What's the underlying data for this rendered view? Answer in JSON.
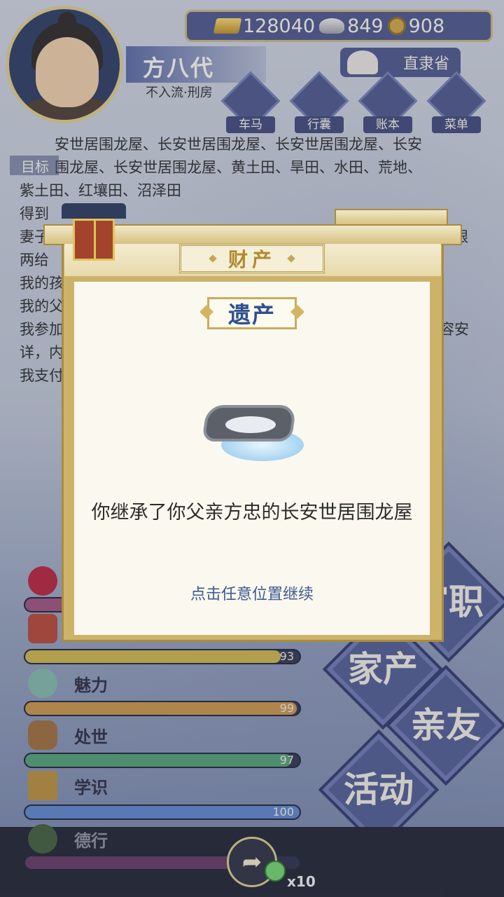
{
  "header": {
    "player_name": "方八代",
    "player_subtitle": "不入流·刑房",
    "resources": {
      "gold": "128040",
      "silver": "849",
      "coins": "908"
    },
    "province": "直隶省",
    "menu": [
      {
        "label": "车马",
        "icon": "carriage-icon"
      },
      {
        "label": "行囊",
        "icon": "bag-icon"
      },
      {
        "label": "账本",
        "icon": "ledger-icon"
      },
      {
        "label": "菜单",
        "icon": "more-icon"
      }
    ]
  },
  "background_text": {
    "goal_tag": "目标",
    "lines": [
      "安世居围龙屋、长安世居围龙屋、长安世居围龙屋、长安",
      "围龙屋、长安世居围龙屋、黄土田、旱田、水田、荒地、",
      "紫土田、红壤田、沼泽田",
      "得到",
      "妻子",
      "两给",
      "我的孩",
      "我的父",
      "我参加",
      "详，内",
      "我支付"
    ],
    "right_fragments": [
      "银",
      "容安"
    ]
  },
  "modal": {
    "title": "财产",
    "subtitle": "遗产",
    "message": "你继承了你父亲方忠的长安世居围龙屋",
    "hint": "点击任意位置继续",
    "item_icon": "walled-house-icon"
  },
  "attributes": [
    {
      "label": "",
      "value": 93,
      "max": 100,
      "color": "#c7b04a",
      "icon": "flower-icon"
    },
    {
      "label": "魅力",
      "value": 99,
      "max": 100,
      "color": "#c49048",
      "icon": "jade-icon"
    },
    {
      "label": "处世",
      "value": 97,
      "max": 100,
      "color": "#4f9c72",
      "icon": "hands-icon"
    },
    {
      "label": "学识",
      "value": 100,
      "max": 100,
      "color": "#5b82c6",
      "icon": "books-icon"
    },
    {
      "label": "德行",
      "value": null,
      "max": 100,
      "color": "#7d3f74",
      "icon": "virtue-icon"
    }
  ],
  "side_actions": [
    {
      "label": "官职"
    },
    {
      "label": "家产"
    },
    {
      "label": "亲友"
    },
    {
      "label": "活动"
    }
  ],
  "bottom": {
    "share_icon": "share-icon",
    "ad_count": "x10"
  }
}
